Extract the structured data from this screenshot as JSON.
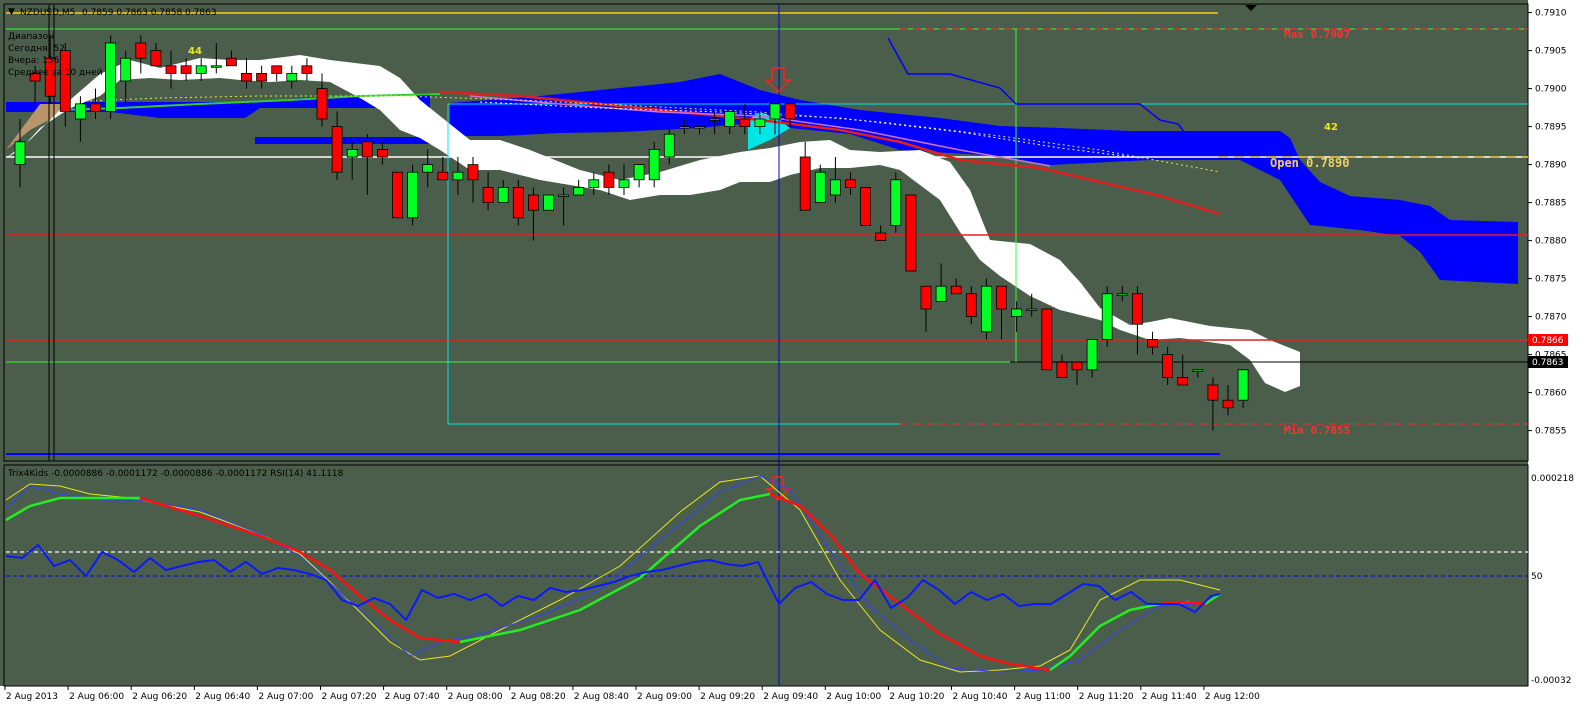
{
  "window": {
    "symbol_header": "NZDUSD,M5",
    "ohlc": "0.7859 0.7863 0.7858 0.7863",
    "info_lines": [
      "Диапазон",
      "Сегодня: 52",
      "Вчера: 136",
      "Среднее за 10 дней"
    ],
    "indicator_header": "Trix4Kids -0.0000886 -0.0001172 -0.0000886 -0.0001172 RSI(14) 41.1118"
  },
  "annotations": {
    "max_label": "Max 0.7907",
    "min_label": "Min 0.7855",
    "open_label": "Open 0.7890",
    "count_44": "44",
    "count_42": "42"
  },
  "price_axis": {
    "ticks": [
      "0.7910",
      "0.7905",
      "0.7900",
      "0.7895",
      "0.7890",
      "0.7885",
      "0.7880",
      "0.7875",
      "0.7870",
      "0.7865",
      "0.7860",
      "0.7855"
    ],
    "current_price": "0.7863",
    "red_line_price": "0.7866"
  },
  "indicator_axis": {
    "ticks": [
      "0.000218",
      "50",
      "-0.00032"
    ]
  },
  "time_axis": {
    "ticks": [
      "2 Aug 2013",
      "2 Aug 06:00",
      "2 Aug 06:20",
      "2 Aug 06:40",
      "2 Aug 07:00",
      "2 Aug 07:20",
      "2 Aug 07:40",
      "2 Aug 08:00",
      "2 Aug 08:20",
      "2 Aug 08:40",
      "2 Aug 09:00",
      "2 Aug 09:20",
      "2 Aug 09:40",
      "2 Aug 10:00",
      "2 Aug 10:20",
      "2 Aug 10:40",
      "2 Aug 11:00",
      "2 Aug 11:20",
      "2 Aug 11:40",
      "2 Aug 12:00"
    ]
  },
  "colors": {
    "background": "#4b5e4b",
    "bull": "#00ff22",
    "bear": "#ff0000",
    "cloud": "#0000ff",
    "kumo_white": "#ffffff",
    "axis_bg": "#ffffff",
    "cyan": "#00e5e5",
    "gold": "#d4b020"
  },
  "chart_data": {
    "type": "candlestick",
    "timeframe": "M5",
    "ylim": [
      0.7851,
      0.7911
    ],
    "candles": [
      {
        "o": 0.789,
        "h": 0.7896,
        "l": 0.7887,
        "c": 0.7893
      },
      {
        "o": 0.7902,
        "h": 0.7903,
        "l": 0.7898,
        "c": 0.7901
      },
      {
        "o": 0.7904,
        "h": 0.7907,
        "l": 0.7898,
        "c": 0.7899
      },
      {
        "o": 0.7905,
        "h": 0.7906,
        "l": 0.7895,
        "c": 0.7897
      },
      {
        "o": 0.7896,
        "h": 0.7899,
        "l": 0.7893,
        "c": 0.7898
      },
      {
        "o": 0.7898,
        "h": 0.79,
        "l": 0.7896,
        "c": 0.7897
      },
      {
        "o": 0.7897,
        "h": 0.7907,
        "l": 0.7896,
        "c": 0.7906
      },
      {
        "o": 0.7901,
        "h": 0.7905,
        "l": 0.7898,
        "c": 0.7904
      },
      {
        "o": 0.7906,
        "h": 0.7907,
        "l": 0.7902,
        "c": 0.7904
      },
      {
        "o": 0.7905,
        "h": 0.7906,
        "l": 0.7903,
        "c": 0.7903
      },
      {
        "o": 0.7903,
        "h": 0.7905,
        "l": 0.79,
        "c": 0.7902
      },
      {
        "o": 0.7903,
        "h": 0.7904,
        "l": 0.7901,
        "c": 0.7902
      },
      {
        "o": 0.7902,
        "h": 0.7904,
        "l": 0.7901,
        "c": 0.7903
      },
      {
        "o": 0.7903,
        "h": 0.7906,
        "l": 0.7902,
        "c": 0.7903
      },
      {
        "o": 0.7904,
        "h": 0.7905,
        "l": 0.7903,
        "c": 0.7903
      },
      {
        "o": 0.7902,
        "h": 0.7904,
        "l": 0.79,
        "c": 0.7901
      },
      {
        "o": 0.7902,
        "h": 0.7903,
        "l": 0.79,
        "c": 0.7901
      },
      {
        "o": 0.7903,
        "h": 0.7903,
        "l": 0.7901,
        "c": 0.7902
      },
      {
        "o": 0.7901,
        "h": 0.7903,
        "l": 0.79,
        "c": 0.7902
      },
      {
        "o": 0.7903,
        "h": 0.7904,
        "l": 0.7901,
        "c": 0.7902
      },
      {
        "o": 0.79,
        "h": 0.7902,
        "l": 0.7895,
        "c": 0.7896
      },
      {
        "o": 0.7895,
        "h": 0.7897,
        "l": 0.7888,
        "c": 0.7889
      },
      {
        "o": 0.7891,
        "h": 0.7893,
        "l": 0.7888,
        "c": 0.7892
      },
      {
        "o": 0.7893,
        "h": 0.7894,
        "l": 0.7886,
        "c": 0.7891
      },
      {
        "o": 0.7892,
        "h": 0.7893,
        "l": 0.789,
        "c": 0.7891
      },
      {
        "o": 0.7889,
        "h": 0.7889,
        "l": 0.7883,
        "c": 0.7883
      },
      {
        "o": 0.7883,
        "h": 0.789,
        "l": 0.7882,
        "c": 0.7889
      },
      {
        "o": 0.7889,
        "h": 0.7892,
        "l": 0.7887,
        "c": 0.789
      },
      {
        "o": 0.7889,
        "h": 0.7891,
        "l": 0.7888,
        "c": 0.7888
      },
      {
        "o": 0.7888,
        "h": 0.7891,
        "l": 0.7886,
        "c": 0.7889
      },
      {
        "o": 0.789,
        "h": 0.7891,
        "l": 0.7885,
        "c": 0.7888
      },
      {
        "o": 0.7887,
        "h": 0.7889,
        "l": 0.7884,
        "c": 0.7885
      },
      {
        "o": 0.7885,
        "h": 0.7888,
        "l": 0.7885,
        "c": 0.7887
      },
      {
        "o": 0.7887,
        "h": 0.7888,
        "l": 0.7882,
        "c": 0.7883
      },
      {
        "o": 0.7886,
        "h": 0.7887,
        "l": 0.788,
        "c": 0.7884
      },
      {
        "o": 0.7884,
        "h": 0.7886,
        "l": 0.7884,
        "c": 0.7886
      },
      {
        "o": 0.7886,
        "h": 0.7887,
        "l": 0.7882,
        "c": 0.7886
      },
      {
        "o": 0.7886,
        "h": 0.7888,
        "l": 0.7886,
        "c": 0.7887
      },
      {
        "o": 0.7887,
        "h": 0.7889,
        "l": 0.7886,
        "c": 0.7888
      },
      {
        "o": 0.7889,
        "h": 0.789,
        "l": 0.7886,
        "c": 0.7887
      },
      {
        "o": 0.7887,
        "h": 0.789,
        "l": 0.7886,
        "c": 0.7888
      },
      {
        "o": 0.7888,
        "h": 0.789,
        "l": 0.7887,
        "c": 0.789
      },
      {
        "o": 0.7888,
        "h": 0.7893,
        "l": 0.7887,
        "c": 0.7892
      },
      {
        "o": 0.7891,
        "h": 0.7895,
        "l": 0.789,
        "c": 0.7894
      },
      {
        "o": 0.7895,
        "h": 0.7896,
        "l": 0.7894,
        "c": 0.7895
      },
      {
        "o": 0.7895,
        "h": 0.7896,
        "l": 0.7894,
        "c": 0.7895
      },
      {
        "o": 0.7896,
        "h": 0.7897,
        "l": 0.7894,
        "c": 0.7896
      },
      {
        "o": 0.7895,
        "h": 0.7897,
        "l": 0.7894,
        "c": 0.7897
      },
      {
        "o": 0.7896,
        "h": 0.7898,
        "l": 0.7894,
        "c": 0.7895
      },
      {
        "o": 0.7895,
        "h": 0.7897,
        "l": 0.7894,
        "c": 0.7896
      },
      {
        "o": 0.7896,
        "h": 0.7897,
        "l": 0.7894,
        "c": 0.7898
      },
      {
        "o": 0.7898,
        "h": 0.7898,
        "l": 0.7895,
        "c": 0.7896
      },
      {
        "o": 0.7891,
        "h": 0.7893,
        "l": 0.7884,
        "c": 0.7884
      },
      {
        "o": 0.7885,
        "h": 0.789,
        "l": 0.7885,
        "c": 0.7889
      },
      {
        "o": 0.7886,
        "h": 0.7891,
        "l": 0.7885,
        "c": 0.7888
      },
      {
        "o": 0.7888,
        "h": 0.7889,
        "l": 0.7886,
        "c": 0.7887
      },
      {
        "o": 0.7887,
        "h": 0.7887,
        "l": 0.7882,
        "c": 0.7882
      },
      {
        "o": 0.7881,
        "h": 0.7882,
        "l": 0.788,
        "c": 0.788
      },
      {
        "o": 0.7882,
        "h": 0.7889,
        "l": 0.7881,
        "c": 0.7888
      },
      {
        "o": 0.7886,
        "h": 0.7886,
        "l": 0.7876,
        "c": 0.7876
      },
      {
        "o": 0.7874,
        "h": 0.7874,
        "l": 0.7868,
        "c": 0.7871
      },
      {
        "o": 0.7872,
        "h": 0.7877,
        "l": 0.7872,
        "c": 0.7874
      },
      {
        "o": 0.7874,
        "h": 0.7875,
        "l": 0.7873,
        "c": 0.7873
      },
      {
        "o": 0.7873,
        "h": 0.7874,
        "l": 0.7869,
        "c": 0.787
      },
      {
        "o": 0.7868,
        "h": 0.7875,
        "l": 0.7867,
        "c": 0.7874
      },
      {
        "o": 0.7874,
        "h": 0.7874,
        "l": 0.7867,
        "c": 0.7871
      },
      {
        "o": 0.787,
        "h": 0.7872,
        "l": 0.7868,
        "c": 0.7871
      },
      {
        "o": 0.7871,
        "h": 0.7873,
        "l": 0.787,
        "c": 0.7871
      },
      {
        "o": 0.7871,
        "h": 0.7871,
        "l": 0.7863,
        "c": 0.7863
      },
      {
        "o": 0.7864,
        "h": 0.7865,
        "l": 0.7862,
        "c": 0.7862
      },
      {
        "o": 0.7864,
        "h": 0.7864,
        "l": 0.7861,
        "c": 0.7863
      },
      {
        "o": 0.7863,
        "h": 0.7866,
        "l": 0.7862,
        "c": 0.7867
      },
      {
        "o": 0.7867,
        "h": 0.7874,
        "l": 0.7866,
        "c": 0.7873
      },
      {
        "o": 0.7873,
        "h": 0.7874,
        "l": 0.7872,
        "c": 0.7873
      },
      {
        "o": 0.7873,
        "h": 0.7874,
        "l": 0.7865,
        "c": 0.7869
      },
      {
        "o": 0.7867,
        "h": 0.7868,
        "l": 0.7865,
        "c": 0.7866
      },
      {
        "o": 0.7865,
        "h": 0.7866,
        "l": 0.7861,
        "c": 0.7862
      },
      {
        "o": 0.7862,
        "h": 0.7865,
        "l": 0.7861,
        "c": 0.7861
      },
      {
        "o": 0.7863,
        "h": 0.7863,
        "l": 0.7862,
        "c": 0.7863
      },
      {
        "o": 0.7861,
        "h": 0.7862,
        "l": 0.7855,
        "c": 0.7859
      },
      {
        "o": 0.7859,
        "h": 0.7861,
        "l": 0.7857,
        "c": 0.7858
      },
      {
        "o": 0.7859,
        "h": 0.7863,
        "l": 0.7858,
        "c": 0.7863
      }
    ]
  }
}
